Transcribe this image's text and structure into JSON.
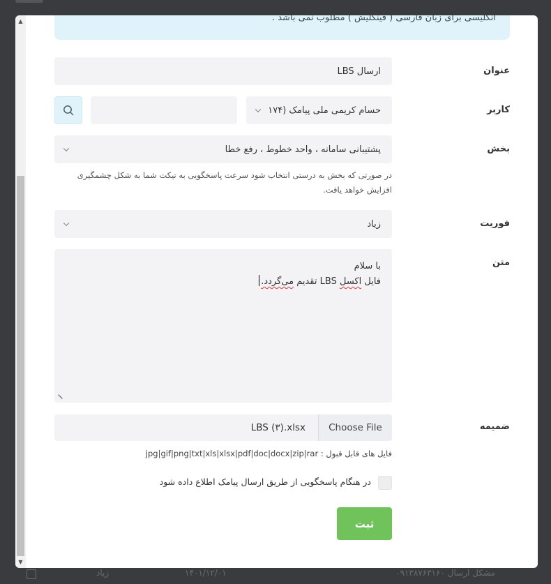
{
  "background": {
    "row_subject": "مشکل ارسال",
    "row_number": "۰۹۱۳۸۷۶۳۱۶۰",
    "row_date": "۱۴۰۱/۱۲/۰۱",
    "row_priority": "زیاد"
  },
  "notice": {
    "text": "انگلیسی برای زبان فارسی ( فینگلیش ) مطلوب نمی باشد ."
  },
  "form": {
    "title_label": "عنوان",
    "title_value": "ارسال LBS",
    "user_label": "کاربر",
    "user_selected": "حسام کریمی ملی پیامک (۱۷۴",
    "user_search_value": "",
    "section_label": "بخش",
    "section_selected": "پشتیبانی سامانه ، واحد خطوط ، رفع خطا",
    "section_hint": "در صورتی که بخش به درستی انتخاب شود سرعت پاسخگویی به تیکت شما به شکل چشمگیری افزایش خواهد یافت.",
    "priority_label": "فوریت",
    "priority_selected": "زیاد",
    "body_label": "متن",
    "body_line1": "با سلام",
    "body_line2_a": "فایل ",
    "body_line2_b": "اکسل",
    "body_line2_c": " LBS تقدیم ",
    "body_line2_d": "می‌گردد.",
    "attachment_label": "ضمیمه",
    "file_button": "Choose File",
    "file_name": "LBS (۳).xlsx",
    "accepted_types": "فایل های قابل قبول : jpg|gif|png|txt|xls|xlsx|pdf|doc|docx|zip|rar",
    "notify_label": "در هنگام پاسخگویی از طریق ارسال پیامک اطلاع داده شود",
    "submit_label": "ثبت"
  },
  "colors": {
    "accent_info": "#e0f2fa",
    "submit_green": "#6fc35a",
    "field_bg": "#f3f3f6"
  }
}
